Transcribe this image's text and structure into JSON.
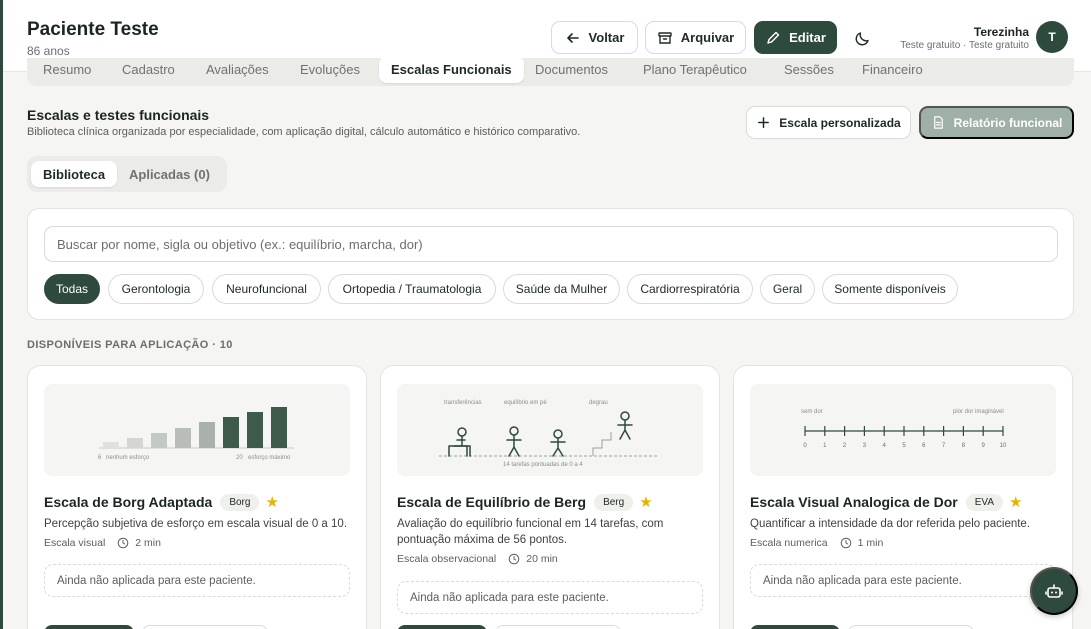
{
  "patient": {
    "name": "Paciente Teste",
    "age": "86 anos"
  },
  "header": {
    "back_label": "Voltar",
    "archive_label": "Arquivar",
    "edit_label": "Editar"
  },
  "user": {
    "name": "Terezinha",
    "plan": "Teste gratuito · Teste gratuito",
    "initial": "T"
  },
  "tabs": [
    "Resumo",
    "Cadastro",
    "Avaliações",
    "Evoluções",
    "Escalas Funcionais",
    "Documentos",
    "Plano Terapêutico",
    "Sessões",
    "Financeiro"
  ],
  "section": {
    "title": "Escalas e testes funcionais",
    "description": "Biblioteca clínica organizada por especialidade, com aplicação digital, cálculo automático e histórico comparativo.",
    "custom_scale_label": "Escala personalizada",
    "report_label": "Relatório funcional"
  },
  "segments": {
    "library": "Biblioteca",
    "applied": "Aplicadas (0)"
  },
  "search": {
    "placeholder": "Buscar por nome, sigla ou objetivo (ex.: equilíbrio, marcha, dor)"
  },
  "filters": [
    "Todas",
    "Gerontologia",
    "Neurofuncional",
    "Ortopedia / Traumatologia",
    "Saúde da Mulher",
    "Cardiorrespiratória",
    "Geral",
    "Somente disponíveis"
  ],
  "available_heading": "DISPONÍVEIS PARA APLICAÇÃO · 10",
  "cards": [
    {
      "title": "Escala de Borg Adaptada",
      "badge": "Borg",
      "description": "Percepção subjetiva de esforço em escala visual de 0 a 10.",
      "type": "Escala visual",
      "duration": "2 min",
      "note": "Ainda não aplicada para este paciente.",
      "illus": {
        "left_label": "6",
        "left_text": "nenhum esforço",
        "right_label": "20",
        "right_text": "esforço máximo"
      }
    },
    {
      "title": "Escala de Equilíbrio de Berg",
      "badge": "Berg",
      "description": "Avaliação do equilíbrio funcional em 14 tarefas, com pontuação máxima de 56 pontos.",
      "type": "Escala observacional",
      "duration": "20 min",
      "note": "Ainda não aplicada para este paciente.",
      "illus": {
        "label1": "transferências",
        "label2": "equilíbrio em pé",
        "label3": "degrau",
        "caption": "14 tarefas pontuadas de 0 a 4"
      }
    },
    {
      "title": "Escala Visual Analogica de Dor",
      "badge": "EVA",
      "description": "Quantificar a intensidade da dor referida pelo paciente.",
      "type": "Escala numerica",
      "duration": "1 min",
      "note": "Ainda não aplicada para este paciente.",
      "illus": {
        "left_text": "sem dor",
        "right_text": "pior dor imaginável",
        "ticks": [
          "0",
          "1",
          "2",
          "3",
          "4",
          "5",
          "6",
          "7",
          "8",
          "9",
          "10"
        ]
      }
    }
  ],
  "colors": {
    "primary": "#2e4a3d",
    "star": "#e6b400"
  }
}
